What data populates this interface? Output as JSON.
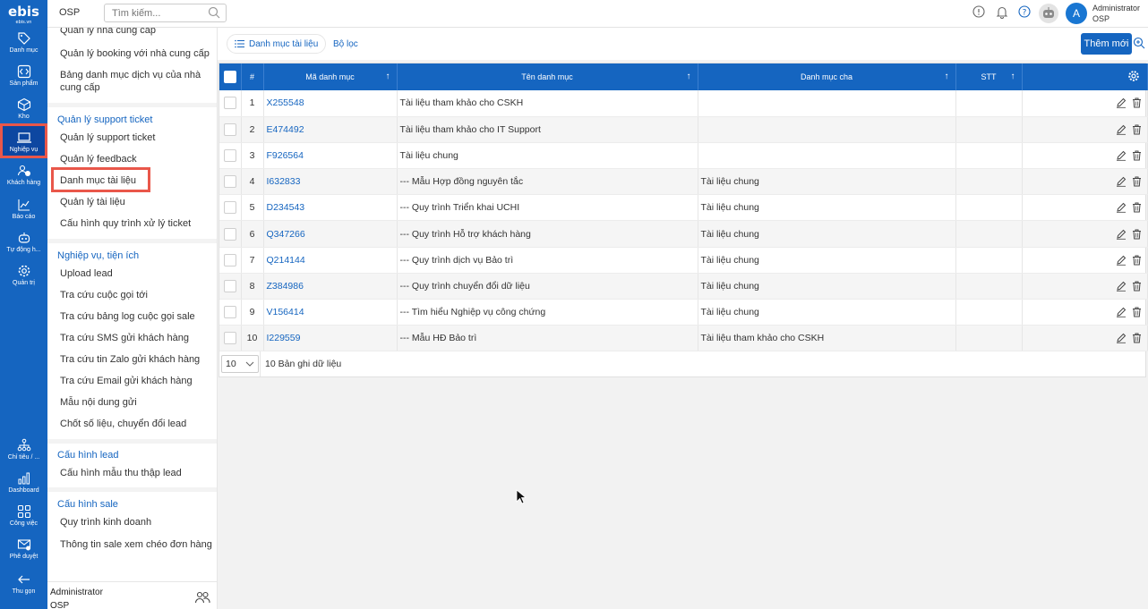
{
  "app": {
    "logo_text": "ebis",
    "logo_subtext": "ebis.vn",
    "company": "OSP"
  },
  "search": {
    "placeholder": "Tìm kiếm..."
  },
  "user": {
    "avatar_letter": "A",
    "name": "Administrator",
    "org": "OSP"
  },
  "rail": [
    {
      "label": "Danh mục",
      "icon": "tag-icon"
    },
    {
      "label": "Sản phẩm",
      "icon": "code-icon"
    },
    {
      "label": "Kho",
      "icon": "box-icon"
    },
    {
      "label": "Nghiệp vụ",
      "icon": "laptop-icon"
    },
    {
      "label": "Khách hàng",
      "icon": "users-icon"
    },
    {
      "label": "Báo cáo",
      "icon": "chart-icon"
    },
    {
      "label": "Tự động h...",
      "icon": "robot-icon"
    },
    {
      "label": "Quản trị",
      "icon": "gear-icon"
    },
    {
      "label": "Chỉ tiêu / ...",
      "icon": "org-icon"
    },
    {
      "label": "Dashboard",
      "icon": "dashboard-icon"
    },
    {
      "label": "Công việc",
      "icon": "tasks-icon"
    },
    {
      "label": "Phê duyệt",
      "icon": "approve-icon"
    },
    {
      "label": "Thu gọn",
      "icon": "arrow-left-icon"
    }
  ],
  "submenu": {
    "top_items": [
      "Quản lý nhà cung cấp",
      "Quản lý booking với nhà cung cấp",
      "Bảng danh mục dịch vụ của nhà cung cấp"
    ],
    "section1": {
      "title": "Quản lý support ticket",
      "items": [
        "Quản lý support ticket",
        "Quản lý feedback",
        "Danh mục tài liệu",
        "Quản lý tài liệu",
        "Cấu hình quy trình xử lý ticket"
      ]
    },
    "section2": {
      "title": "Nghiệp vụ, tiện ích",
      "items": [
        "Upload lead",
        "Tra cứu cuộc gọi tới",
        "Tra cứu bảng log cuộc gọi sale",
        "Tra cứu SMS gửi khách hàng",
        "Tra cứu tin Zalo gửi khách hàng",
        "Tra cứu Email gửi khách hàng",
        "Mẫu nội dung gửi",
        "Chốt số liệu, chuyển đổi lead"
      ]
    },
    "section3": {
      "title": "Cấu hình lead",
      "items": [
        "Cấu hình mẫu thu thập lead"
      ]
    },
    "section4": {
      "title": "Cấu hình sale",
      "items": [
        "Quy trình kinh doanh",
        "Thông tin sale xem chéo đơn hàng"
      ]
    }
  },
  "toolbar": {
    "tab_label": "Danh mục tài liệu",
    "filter_label": "Bộ lọc",
    "add_label": "Thêm mới"
  },
  "table": {
    "headers": {
      "num": "#",
      "code": "Mã danh mục",
      "name": "Tên danh mục",
      "parent": "Danh mục cha",
      "order": "STT"
    },
    "rows": [
      {
        "num": "1",
        "code": "X255548",
        "name": "Tài liệu tham khảo cho CSKH",
        "parent": "",
        "order": ""
      },
      {
        "num": "2",
        "code": "E474492",
        "name": "Tài liệu tham khảo cho IT Support",
        "parent": "",
        "order": ""
      },
      {
        "num": "3",
        "code": "F926564",
        "name": "Tài liệu chung",
        "parent": "",
        "order": ""
      },
      {
        "num": "4",
        "code": "I632833",
        "name": "--- Mẫu Hợp đồng nguyên tắc",
        "parent": "Tài liệu chung",
        "order": ""
      },
      {
        "num": "5",
        "code": "D234543",
        "name": "--- Quy trình Triển khai UCHI",
        "parent": "Tài liệu chung",
        "order": ""
      },
      {
        "num": "6",
        "code": "Q347266",
        "name": "--- Quy trình Hỗ trợ khách hàng",
        "parent": "Tài liệu chung",
        "order": ""
      },
      {
        "num": "7",
        "code": "Q214144",
        "name": "--- Quy trình dịch vụ Bảo trì",
        "parent": "Tài liệu chung",
        "order": ""
      },
      {
        "num": "8",
        "code": "Z384986",
        "name": "--- Quy trình chuyển đổi dữ liệu",
        "parent": "Tài liệu chung",
        "order": ""
      },
      {
        "num": "9",
        "code": "V156414",
        "name": "--- Tìm hiểu Nghiệp vụ công chứng",
        "parent": "Tài liệu chung",
        "order": ""
      },
      {
        "num": "10",
        "code": "I229559",
        "name": "--- Mẫu HĐ Bảo trì",
        "parent": "Tài liệu tham khảo cho CSKH",
        "order": ""
      }
    ],
    "page_size": "10",
    "record_count": "10 Bản ghi dữ liệu"
  },
  "colors": {
    "primary": "#1565c0",
    "highlight": "#e9574a"
  }
}
